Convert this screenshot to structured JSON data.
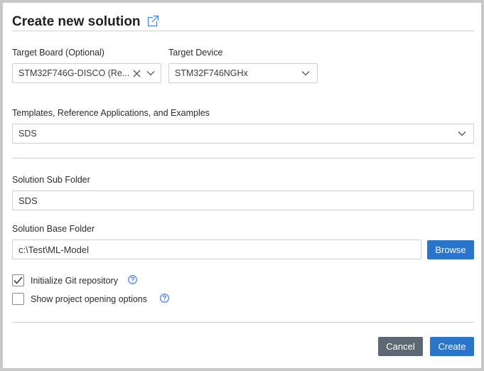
{
  "dialog": {
    "title": "Create new solution",
    "target_board": {
      "label": "Target Board (Optional)",
      "value": "STM32F746G-DISCO (Re..."
    },
    "target_device": {
      "label": "Target Device",
      "value": "STM32F746NGHx"
    },
    "templates": {
      "label": "Templates, Reference Applications, and Examples",
      "value": "SDS"
    },
    "sub_folder": {
      "label": "Solution Sub Folder",
      "value": "SDS"
    },
    "base_folder": {
      "label": "Solution Base Folder",
      "value": "c:\\Test\\ML-Model",
      "browse_label": "Browse"
    },
    "options": {
      "git": {
        "label": "Initialize Git repository",
        "checked": true
      },
      "project_opening": {
        "label": "Show project opening options",
        "checked": false
      }
    },
    "buttons": {
      "cancel": "Cancel",
      "create": "Create"
    }
  },
  "colors": {
    "primary": "#2a74c9",
    "secondary": "#5e6873",
    "help_icon": "#3a6fd8"
  },
  "icons": {
    "external_link": "external-link-icon",
    "chevron": "chevron-down-icon",
    "clear": "close-icon",
    "check": "checkmark-icon",
    "help": "help-circle-icon"
  }
}
